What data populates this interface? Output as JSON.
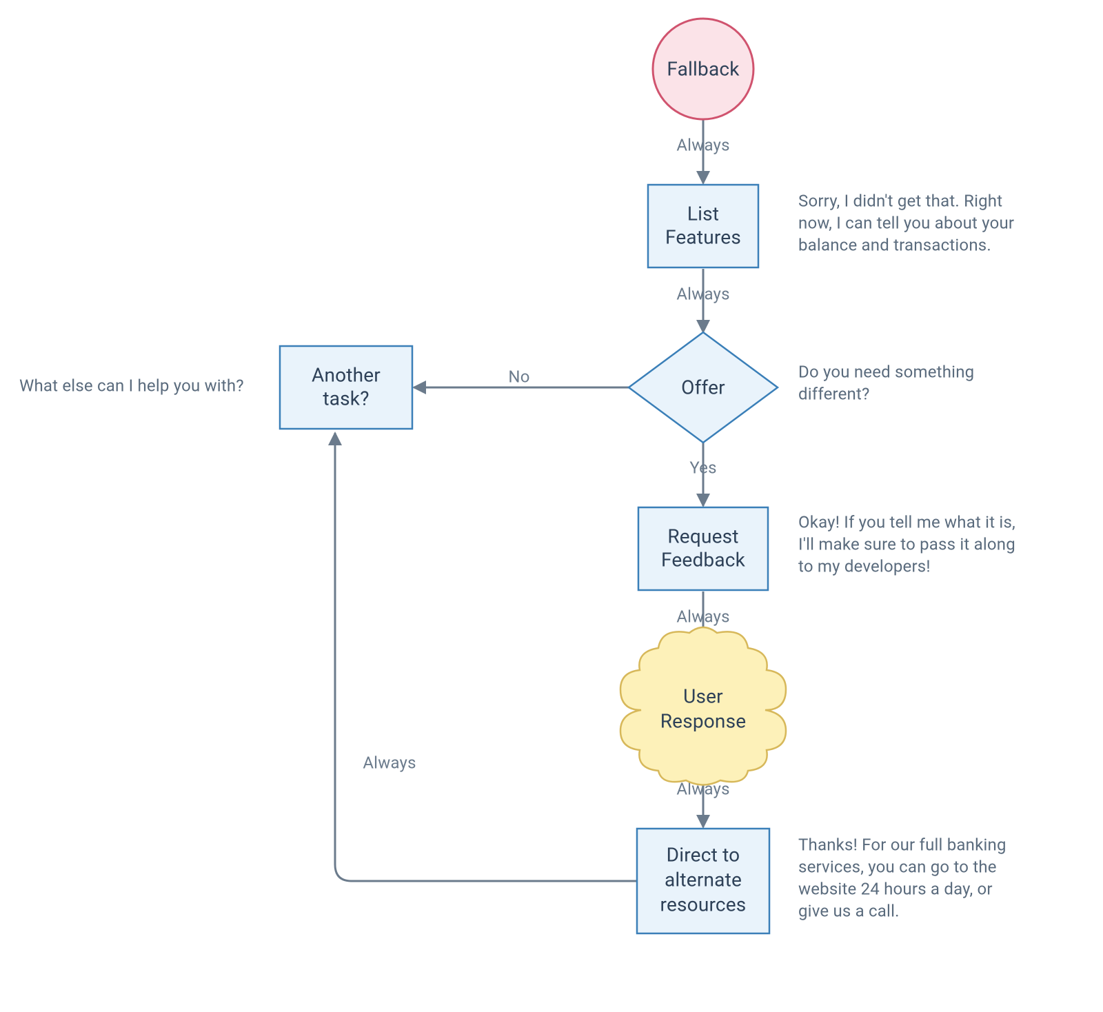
{
  "nodes": {
    "fallback": {
      "label": "Fallback"
    },
    "list_features_1": {
      "label": "List"
    },
    "list_features_2": {
      "label": "Features"
    },
    "offer": {
      "label": "Offer"
    },
    "another_task_1": {
      "label": "Another"
    },
    "another_task_2": {
      "label": "task?"
    },
    "request_fb_1": {
      "label": "Request"
    },
    "request_fb_2": {
      "label": "Feedback"
    },
    "user_resp_1": {
      "label": "User"
    },
    "user_resp_2": {
      "label": "Response"
    },
    "direct_1": {
      "label": "Direct to"
    },
    "direct_2": {
      "label": "alternate"
    },
    "direct_3": {
      "label": "resources"
    }
  },
  "edges": {
    "e_fallback_list": {
      "label": "Always"
    },
    "e_list_offer": {
      "label": "Always"
    },
    "e_offer_no": {
      "label": "No"
    },
    "e_offer_yes": {
      "label": "Yes"
    },
    "e_request_user": {
      "label": "Always"
    },
    "e_user_direct": {
      "label": "Always"
    },
    "e_direct_another": {
      "label": "Always"
    }
  },
  "notes": {
    "list_features": [
      "Sorry, I didn't get that. Right",
      "now, I can tell you about your",
      "balance and transactions."
    ],
    "offer": [
      "Do you need something",
      "different?"
    ],
    "another_task": [
      "What else can I help you with?"
    ],
    "request_feedback": [
      "Okay! If you tell me what it is,",
      "I'll make sure to pass it along",
      "to my developers!"
    ],
    "direct": [
      "Thanks! For our full banking",
      "services, you can go to the",
      "website 24 hours a day, or",
      "give us a call."
    ]
  }
}
